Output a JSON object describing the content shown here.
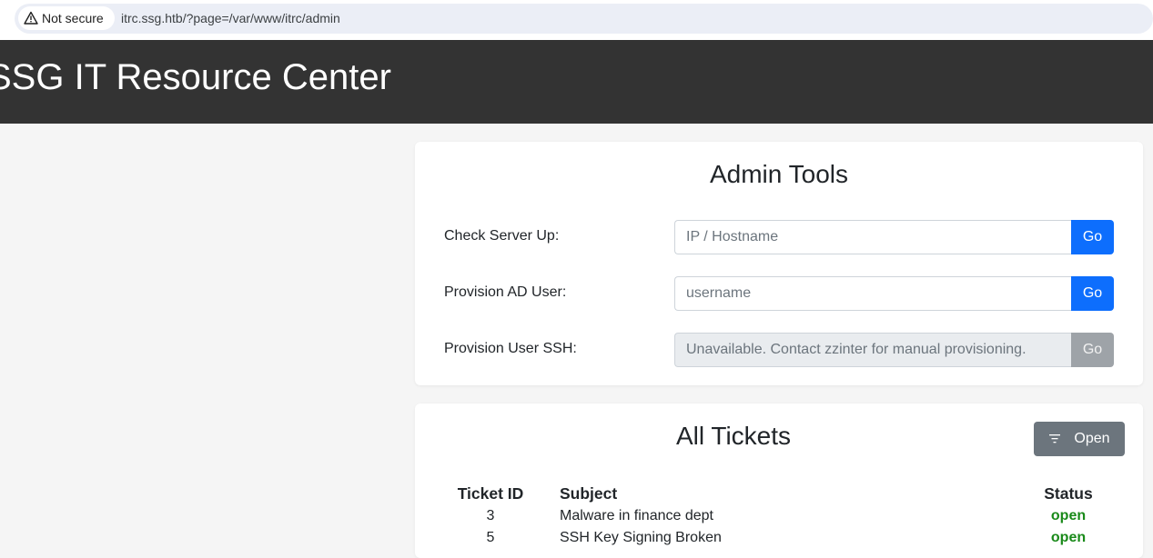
{
  "browser": {
    "security_label": "Not secure",
    "url": "itrc.ssg.htb/?page=/var/www/itrc/admin"
  },
  "header": {
    "title": "SSG IT Resource Center"
  },
  "admin_tools": {
    "title": "Admin Tools",
    "rows": [
      {
        "label": "Check Server Up:",
        "placeholder": "IP / Hostname",
        "value": "",
        "button": "Go",
        "disabled": false
      },
      {
        "label": "Provision AD User:",
        "placeholder": "username",
        "value": "",
        "button": "Go",
        "disabled": false
      },
      {
        "label": "Provision User SSH:",
        "placeholder": "Unavailable. Contact zzinter for manual provisioning.",
        "value": "",
        "button": "Go",
        "disabled": true
      }
    ]
  },
  "tickets": {
    "title": "All Tickets",
    "filter_button": "Open",
    "columns": [
      "Ticket ID",
      "Subject",
      "Status"
    ],
    "rows": [
      {
        "id": "3",
        "subject": "Malware in finance dept",
        "status": "open"
      },
      {
        "id": "5",
        "subject": "SSH Key Signing Broken",
        "status": "open"
      }
    ]
  },
  "colors": {
    "header_bg": "#333333",
    "primary": "#0d6efd",
    "secondary": "#6c757d",
    "status_open": "#1a8a1a"
  },
  "icons": {
    "security": "warning-triangle-icon",
    "filter": "filter-icon"
  }
}
